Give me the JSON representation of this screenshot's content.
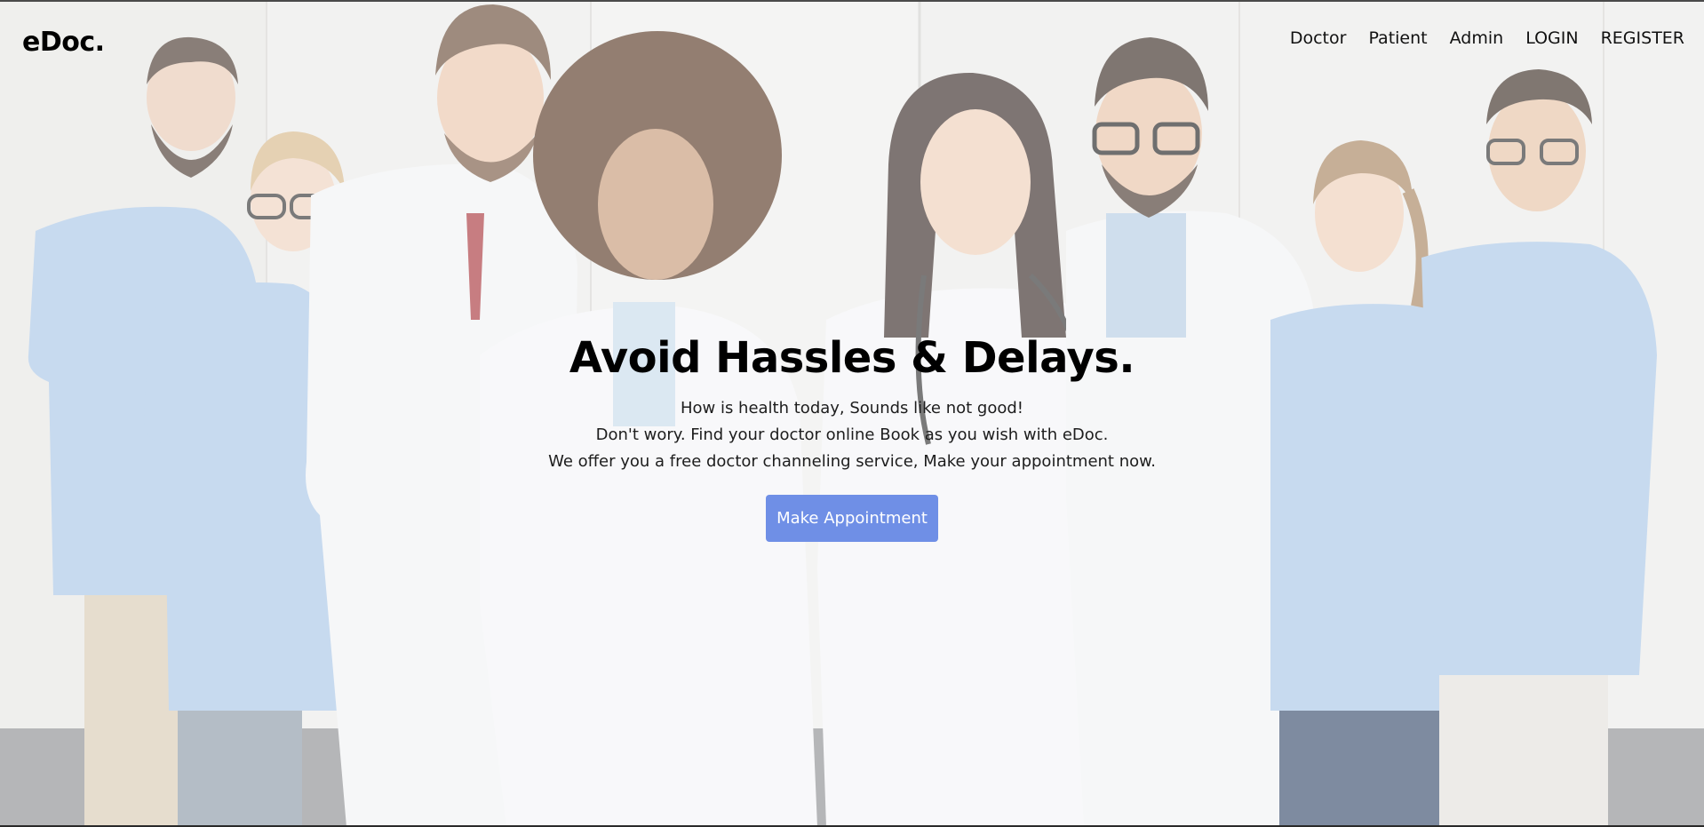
{
  "brand": {
    "logo": "eDoc."
  },
  "nav": {
    "items": [
      {
        "label": "Doctor"
      },
      {
        "label": "Patient"
      },
      {
        "label": "Admin"
      },
      {
        "label": "LOGIN"
      },
      {
        "label": "REGISTER"
      }
    ]
  },
  "hero": {
    "title": "Avoid Hassles & Delays.",
    "lines": [
      "How is health today, Sounds like not good!",
      "Don't wory. Find your doctor online Book as you wish with eDoc.",
      "We offer you a free doctor channeling service, Make your appointment now."
    ],
    "cta_label": "Make Appointment"
  },
  "colors": {
    "accent": "#6f8fe6",
    "scrubs": "#a9c6e6",
    "coat": "#f4f5f7",
    "wall": "#ececea"
  },
  "images": {
    "hero": "group-of-smiling-doctors-and-nurses-photo"
  }
}
